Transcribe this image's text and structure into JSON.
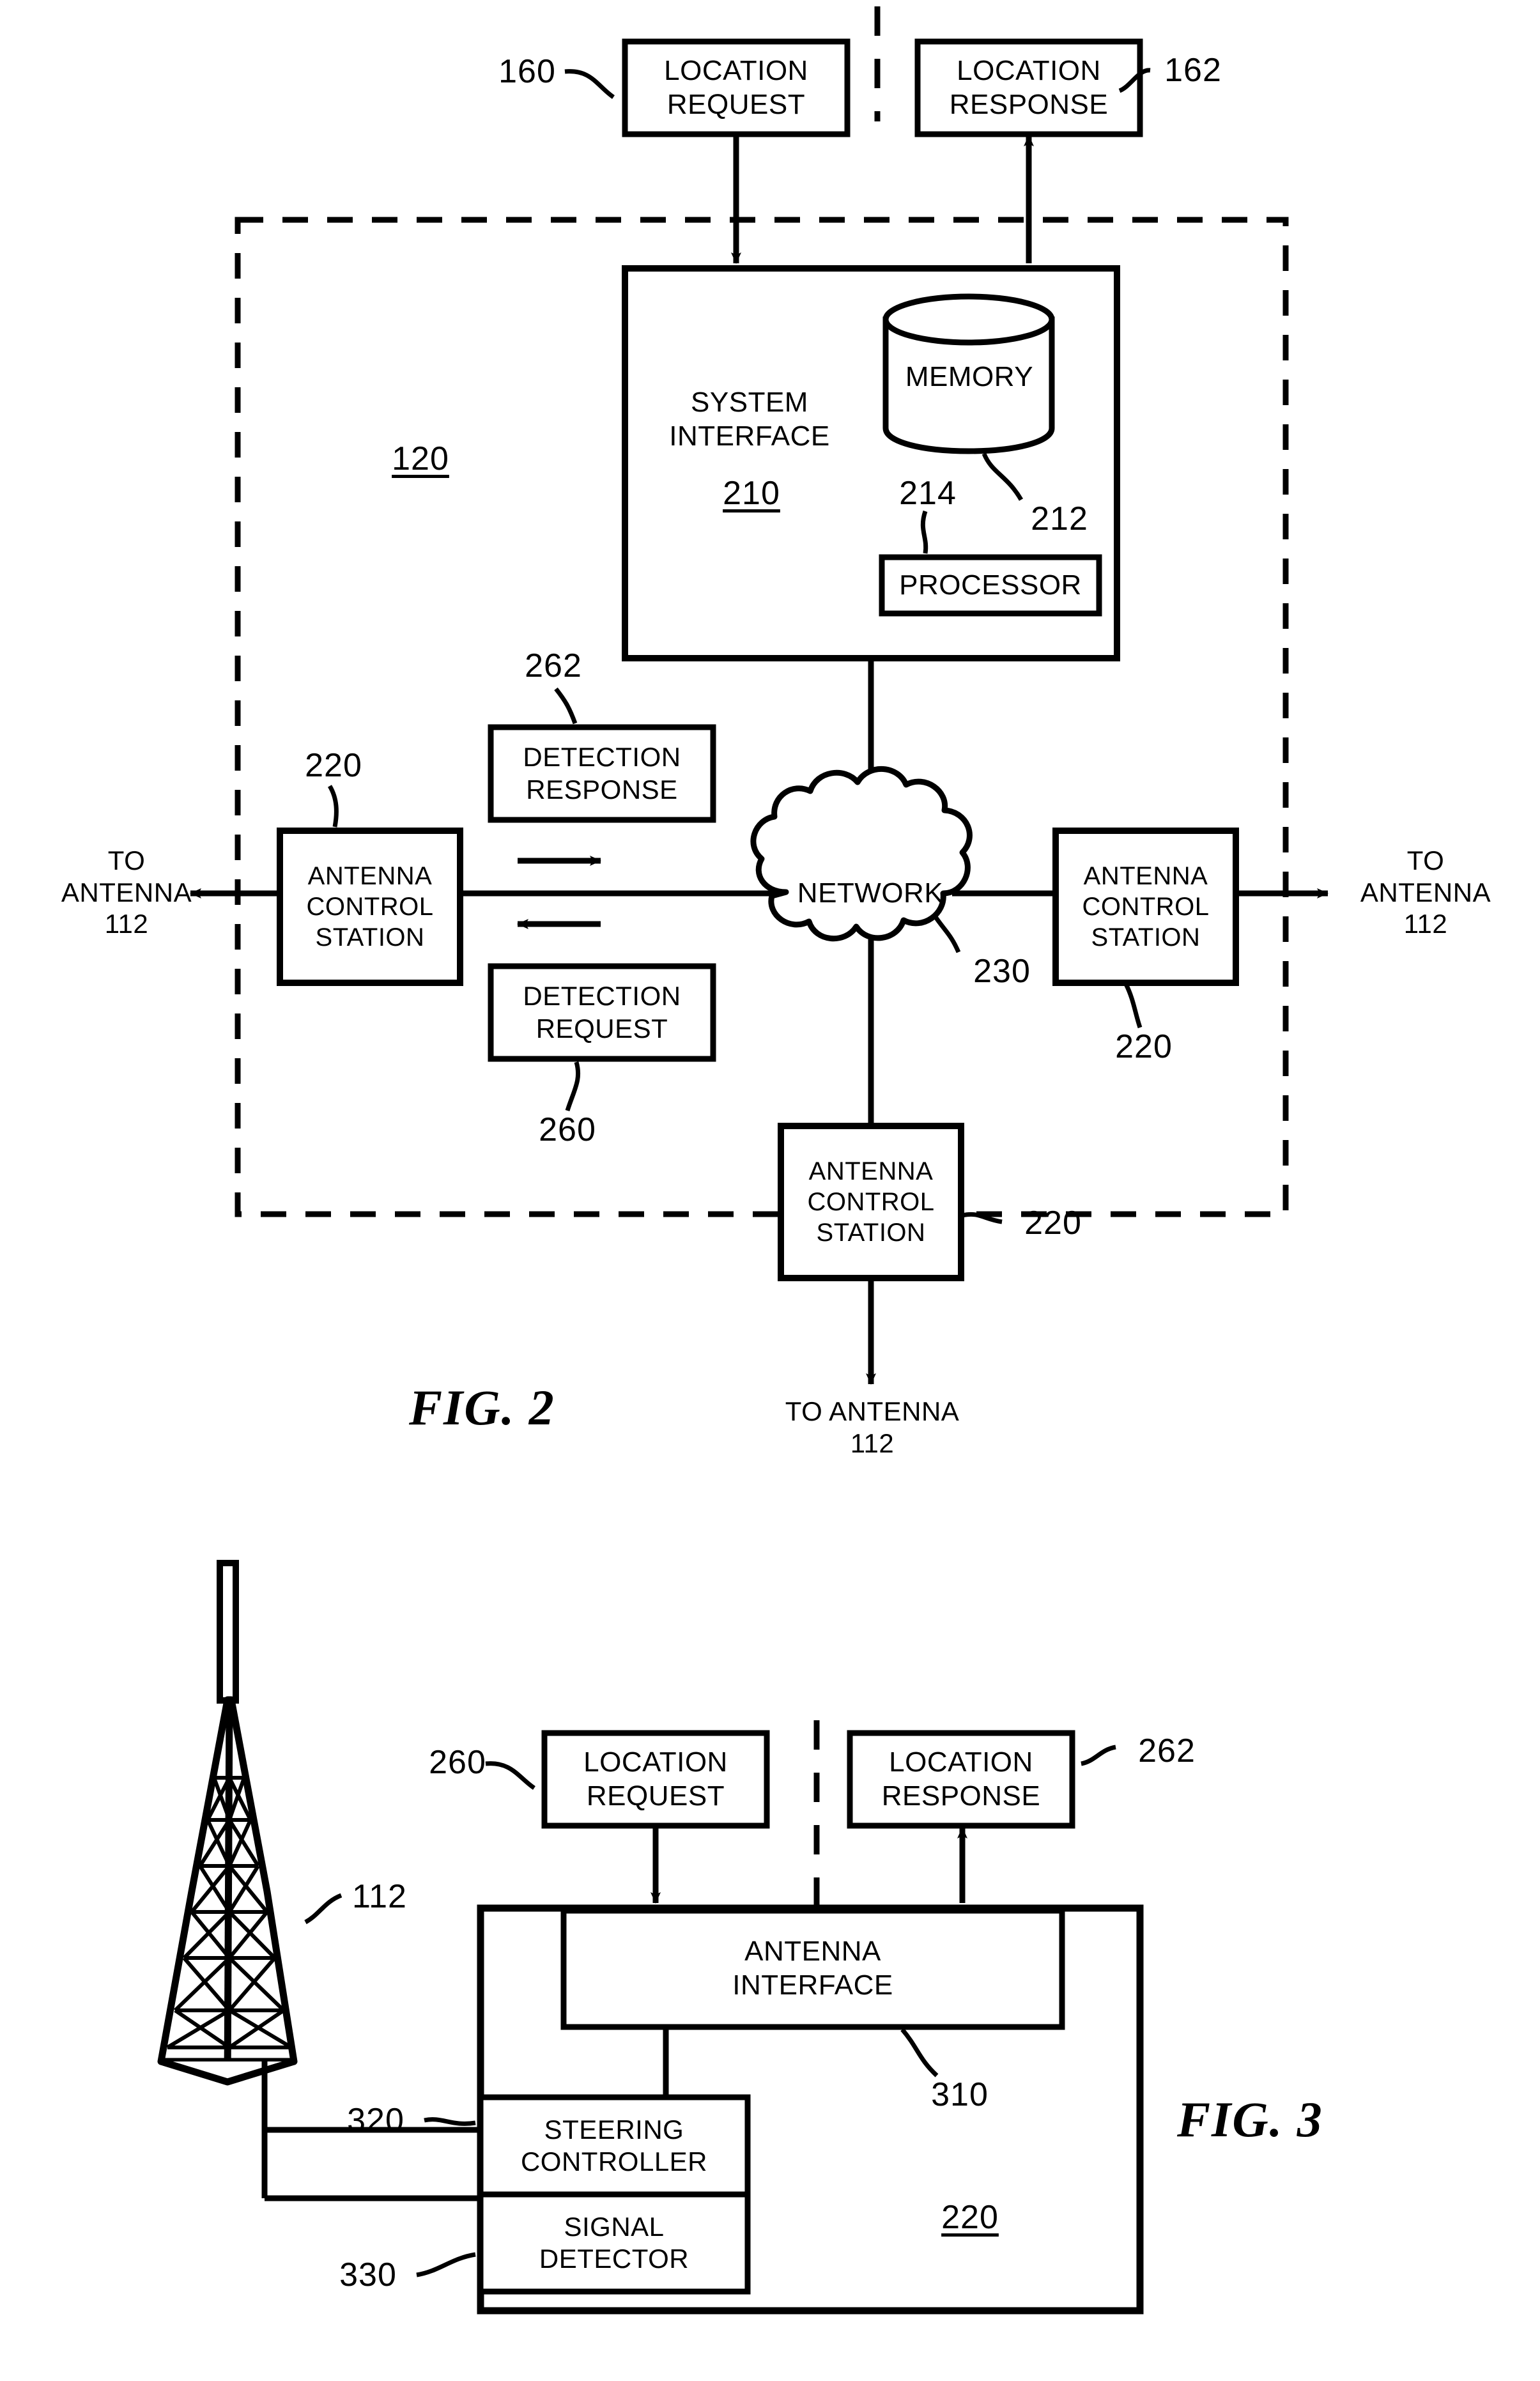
{
  "figure2": {
    "caption": "FIG. 2",
    "system_ref": "120",
    "boxes": {
      "location_request": "LOCATION\nREQUEST",
      "location_request_ref": "160",
      "location_response": "LOCATION\nRESPONSE",
      "location_response_ref": "162",
      "system_interface": "SYSTEM\nINTERFACE",
      "system_interface_ref": "210",
      "memory": "MEMORY",
      "memory_ref": "212",
      "processor": "PROCESSOR",
      "processor_ref": "214",
      "detection_response": "DETECTION\nRESPONSE",
      "detection_response_ref": "262",
      "detection_request": "DETECTION\nREQUEST",
      "detection_request_ref": "260",
      "antenna_control_station_left": "ANTENNA\nCONTROL\nSTATION",
      "antenna_control_station_left_ref": "220",
      "antenna_control_station_right": "ANTENNA\nCONTROL\nSTATION",
      "antenna_control_station_right_ref": "220",
      "antenna_control_station_bottom": "ANTENNA\nCONTROL\nSTATION",
      "antenna_control_station_bottom_ref": "220",
      "network": "NETWORK",
      "network_ref": "230"
    },
    "labels": {
      "to_antenna_left": "TO\nANTENNA\n112",
      "to_antenna_right": "TO\nANTENNA\n112",
      "to_antenna_bottom": "TO ANTENNA\n112"
    }
  },
  "figure3": {
    "caption": "FIG. 3",
    "boxes": {
      "location_request": "LOCATION\nREQUEST",
      "location_request_ref": "260",
      "location_response": "LOCATION\nRESPONSE",
      "location_response_ref": "262",
      "antenna_interface": "ANTENNA\nINTERFACE",
      "antenna_interface_ref": "310",
      "steering_controller": "STEERING\nCONTROLLER",
      "steering_controller_ref": "320",
      "signal_detector": "SIGNAL\nDETECTOR",
      "signal_detector_ref": "330",
      "station_ref": "220"
    },
    "labels": {
      "antenna_tower_ref": "112"
    }
  },
  "colors": {
    "ink": "#000000",
    "paper": "#ffffff"
  }
}
